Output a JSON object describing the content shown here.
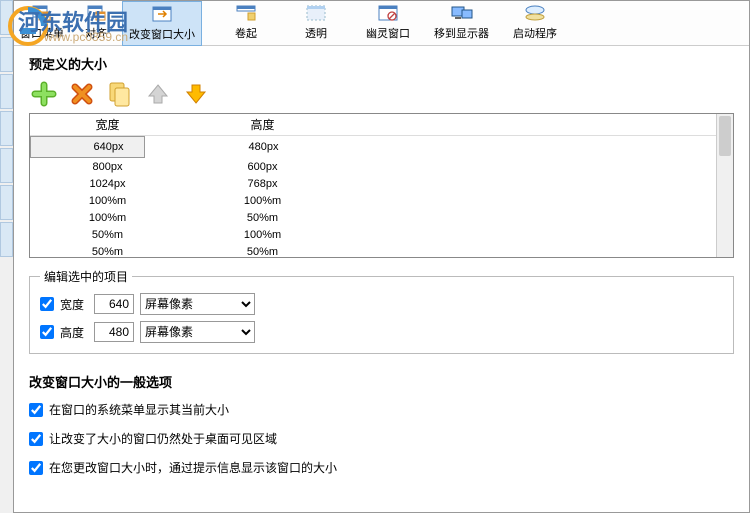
{
  "watermark": {
    "text": "河东软件园",
    "url": "www.pc0359.cn"
  },
  "toolbar": [
    {
      "label": "窗口菜单",
      "name": "window-menu"
    },
    {
      "label": "对齐",
      "name": "align"
    },
    {
      "label": "改变窗口大小",
      "name": "resize"
    },
    {
      "label": "卷起",
      "name": "rollup"
    },
    {
      "label": "透明",
      "name": "transparent"
    },
    {
      "label": "幽灵窗口",
      "name": "ghost"
    },
    {
      "label": "移到显示器",
      "name": "move-to-monitor"
    },
    {
      "label": "启动程序",
      "name": "launch"
    }
  ],
  "section_title": "预定义的大小",
  "grid": {
    "headers": [
      "宽度",
      "高度"
    ],
    "rows": [
      [
        "640px",
        "480px"
      ],
      [
        "800px",
        "600px"
      ],
      [
        "1024px",
        "768px"
      ],
      [
        "100%m",
        "100%m"
      ],
      [
        "100%m",
        "50%m"
      ],
      [
        "50%m",
        "100%m"
      ],
      [
        "50%m",
        "50%m"
      ]
    ]
  },
  "edit_group": {
    "legend": "编辑选中的项目",
    "width_label": "宽度",
    "height_label": "高度",
    "width_value": "640",
    "height_value": "480",
    "unit_option": "屏幕像素"
  },
  "general_options": {
    "title": "改变窗口大小的一般选项",
    "opt1": "在窗口的系统菜单显示其当前大小",
    "opt2": "让改变了大小的窗口仍然处于桌面可见区域",
    "opt3": "在您更改窗口大小时，通过提示信息显示该窗口的大小"
  }
}
